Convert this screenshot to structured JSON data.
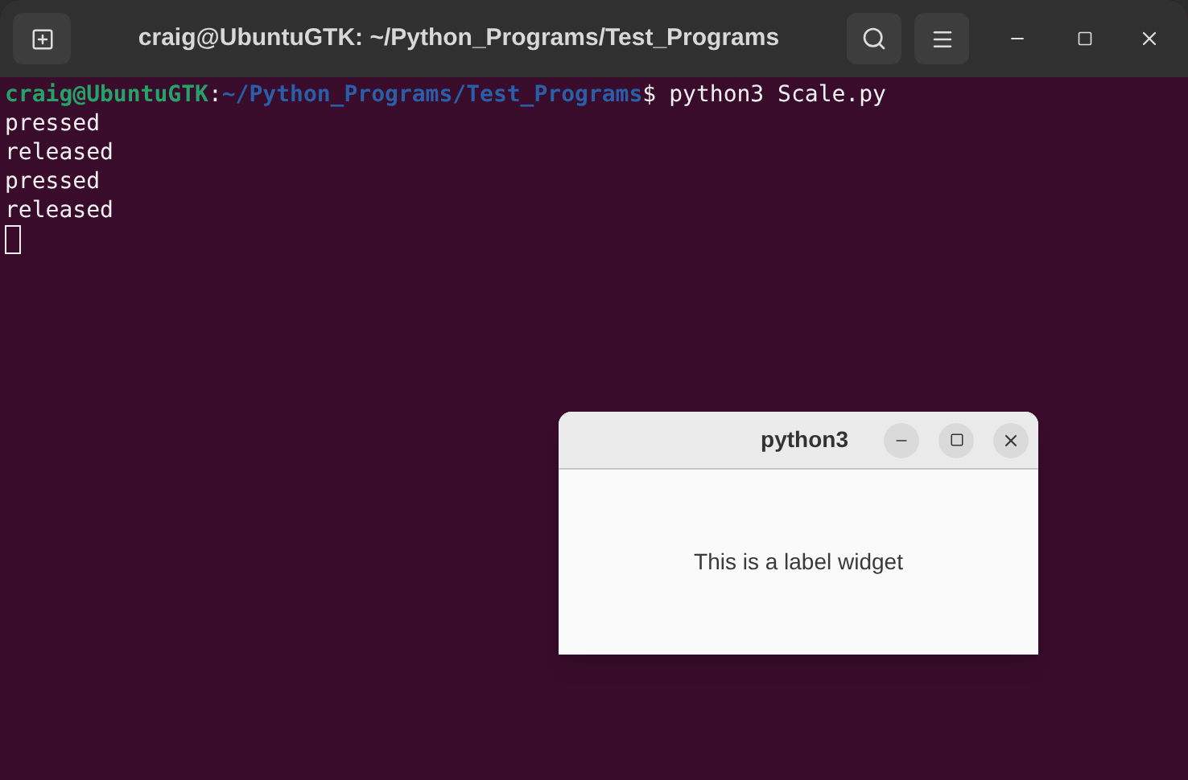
{
  "terminal": {
    "title": "craig@UbuntuGTK: ~/Python_Programs/Test_Programs",
    "prompt": {
      "user_host": "craig@UbuntuGTK",
      "separator": ":",
      "path": "~/Python_Programs/Test_Programs",
      "symbol": "$",
      "command": "python3 Scale.py"
    },
    "output": [
      "pressed",
      "released",
      "pressed",
      "released"
    ]
  },
  "dialog": {
    "title": "python3",
    "label": "This is a label widget"
  }
}
